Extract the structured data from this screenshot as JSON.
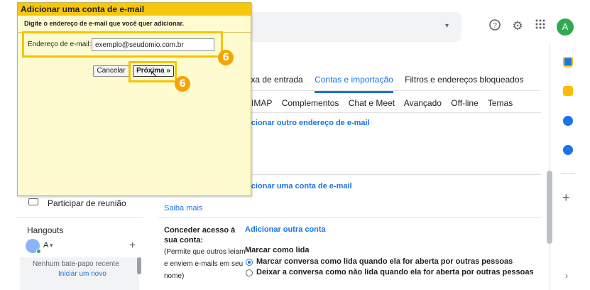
{
  "topbar": {
    "search_caret": "▾",
    "help_icon": "help-circle-icon",
    "settings_icon": "gear-icon",
    "apps_icon": "apps-grid-icon",
    "avatar_letter": "A"
  },
  "settings": {
    "tabs_row1": [
      "aixa de entrada",
      "Contas e importação",
      "Filtros e endereços bloqueados"
    ],
    "tabs_row2": [
      "IMAP",
      "Complementos",
      "Chat e Meet",
      "Avançado",
      "Off-line",
      "Temas"
    ],
    "link_add_address": "dicionar outro endereço de e-mail",
    "link_add_account": "dicionar uma conta de e-mail",
    "learn_more": "Saiba mais",
    "grant_access_label": "Conceder acesso à sua conta:",
    "grant_access_link": "Adicionar outra conta",
    "grant_access_note_1": "(Permite que outros leiam",
    "grant_access_note_2": "e enviem e-mails em seu",
    "grant_access_note_3": "nome)",
    "mark_read_title": "Marcar como lida",
    "radio_option_1": "Marcar conversa como lida quando ela for aberta por outras pessoas",
    "radio_option_2": "Deixar a conversa como não lida quando ela for aberta por outras pessoas"
  },
  "sidebar": {
    "join_meeting": "Participar de reunião",
    "hangouts": "Hangouts",
    "me_name": "A",
    "me_caret": "▾",
    "add_chat": "+",
    "no_recent": "Nenhum bate-papo recente",
    "start_new": "Iniciar um novo"
  },
  "dialog": {
    "title": "Adicionar uma conta de e-mail",
    "prompt": "Digite o endereço de e-mail que você quer adicionar.",
    "email_label": "Endereço de e-mail:",
    "email_value": "exemplo@seudomio.com.br",
    "cancel_label": "Cancelar",
    "next_label": "Próxima »",
    "step_badge_1": "6",
    "step_badge_2": "6"
  },
  "colors": {
    "accent": "#1a73e8",
    "dialog_title_bg": "#f6c70d",
    "dialog_bg": "#fffbd0",
    "highlight": "#f5c400",
    "badge": "#f5a400"
  }
}
